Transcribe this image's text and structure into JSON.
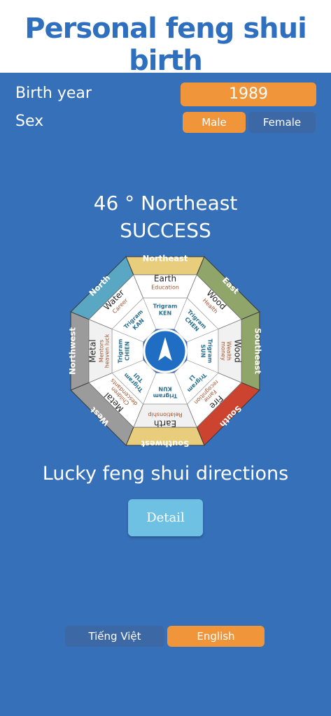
{
  "header": {
    "title": "Personal feng shui birth"
  },
  "form": {
    "birth_year_label": "Birth year",
    "birth_year_value": "1989",
    "sex_label": "Sex",
    "sex_options": [
      "Male",
      "Female"
    ],
    "sex_selected": "Male"
  },
  "result": {
    "direction": "46 ° Northeast",
    "rating": "SUCCESS"
  },
  "bagua": {
    "outer_labels": {
      "n": "North",
      "ne": "Northeast",
      "e": "East",
      "se": "Southeast",
      "s": "South",
      "sw": "Southwest",
      "w": "West",
      "nw": "Northwest"
    },
    "outer_colors": {
      "n": "#5aa7c3",
      "ne": "#e8cd7d",
      "e": "#8fa56a",
      "se": "#8fa56a",
      "s": "#cc4430",
      "sw": "#e8cd7d",
      "w": "#9b9b9b",
      "nw": "#9b9b9b"
    },
    "sectors": {
      "n": {
        "element": "Water",
        "aspect": "Career",
        "trigram": "Trigram",
        "trigram_name": "KAN"
      },
      "ne": {
        "element": "Earth",
        "aspect": "Education",
        "trigram": "Trigram",
        "trigram_name": "KEN"
      },
      "e": {
        "element": "Wood",
        "aspect": "Health",
        "trigram": "Trigram",
        "trigram_name": "CHEN"
      },
      "se": {
        "element": "Wood",
        "aspect": "Wealth",
        "aspect2": "money",
        "trigram": "Trigram",
        "trigram_name": "SUN"
      },
      "s": {
        "element": "Fire",
        "aspect": "Fame",
        "aspect2": "recognition",
        "trigram": "Trigram",
        "trigram_name": "LI"
      },
      "sw": {
        "element": "Earth",
        "aspect": "Relationship",
        "trigram": "Trigram",
        "trigram_name": "KUN"
      },
      "w": {
        "element": "Metal",
        "aspect": "Children",
        "aspect2": "descendants",
        "trigram": "Trigram",
        "trigram_name": "TUI"
      },
      "nw": {
        "element": "Metal",
        "aspect": "Mentors",
        "aspect2": "heaven luck",
        "trigram": "Trigram",
        "trigram_name": "CHIEN"
      }
    },
    "compass_heading_degrees": 46
  },
  "lucky": {
    "title": "Lucky feng shui directions",
    "detail_label": "Detail"
  },
  "language": {
    "options": [
      "Tiếng Việt",
      "English"
    ],
    "selected": "English"
  },
  "colors": {
    "background": "#3570b8",
    "accent": "#f0953a",
    "inactive": "#3d68a6",
    "detail": "#6fc1e4"
  }
}
